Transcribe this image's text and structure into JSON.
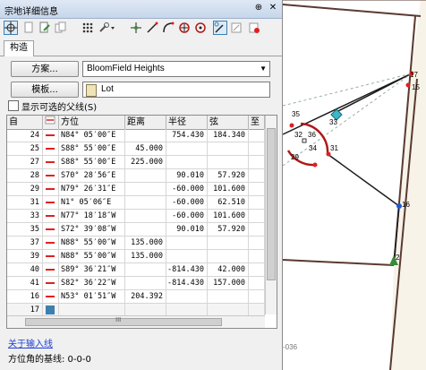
{
  "window": {
    "title": "宗地详细信息",
    "pin": "⊕",
    "close": "✕"
  },
  "tabs": [
    {
      "label": "构造"
    }
  ],
  "scheme": {
    "button": "方案...",
    "value": "BloomField Heights"
  },
  "template": {
    "button": "模板...",
    "value": "Lot"
  },
  "show_parent": {
    "label": "显示可选的父线(S)",
    "checked": false
  },
  "grid": {
    "columns": [
      "自",
      "",
      "方位",
      "距离",
      "半径",
      "弦",
      "至"
    ],
    "rows": [
      {
        "from": "24",
        "bearing": "N84° 05′00″E",
        "distance": "",
        "radius": "754.430",
        "chord": "184.340"
      },
      {
        "from": "25",
        "bearing": "S88° 55′00″E",
        "distance": "45.000",
        "radius": "",
        "chord": ""
      },
      {
        "from": "27",
        "bearing": "S88° 55′00″E",
        "distance": "225.000",
        "radius": "",
        "chord": ""
      },
      {
        "from": "28",
        "bearing": "S70° 28′56″E",
        "distance": "",
        "radius": "90.010",
        "chord": "57.920"
      },
      {
        "from": "29",
        "bearing": "N79° 26′31″E",
        "distance": "",
        "radius": "-60.000",
        "chord": "101.600"
      },
      {
        "from": "31",
        "bearing": "N1° 05′06″E",
        "distance": "",
        "radius": "-60.000",
        "chord": "62.510"
      },
      {
        "from": "33",
        "bearing": "N77° 18′18″W",
        "distance": "",
        "radius": "-60.000",
        "chord": "101.600"
      },
      {
        "from": "35",
        "bearing": "S72° 39′08″W",
        "distance": "",
        "radius": "90.010",
        "chord": "57.920"
      },
      {
        "from": "37",
        "bearing": "N88° 55′00″W",
        "distance": "135.000",
        "radius": "",
        "chord": ""
      },
      {
        "from": "39",
        "bearing": "N88° 55′00″W",
        "distance": "135.000",
        "radius": "",
        "chord": ""
      },
      {
        "from": "40",
        "bearing": "S89° 36′21″W",
        "distance": "",
        "radius": "-814.430",
        "chord": "42.000"
      },
      {
        "from": "41",
        "bearing": "S82° 36′22″W",
        "distance": "",
        "radius": "-814.430",
        "chord": "157.000"
      },
      {
        "from": "16",
        "bearing": "N53° 01′51″W",
        "distance": "204.392",
        "radius": "",
        "chord": ""
      },
      {
        "from": "17",
        "bearing": "",
        "distance": "",
        "radius": "",
        "chord": ""
      }
    ],
    "hscroll_label": "III"
  },
  "link": "关于输入线",
  "footer": "方位角的基线: 0-0-0",
  "map": {
    "labels": [
      "35",
      "33",
      "32",
      "36",
      "34",
      "31",
      "29",
      "17",
      "15",
      "16",
      "2",
      "-036"
    ]
  },
  "colors": {
    "accent": "#3c7fb1",
    "line_red": "#e02020",
    "arc_red": "#b01818",
    "parcel_brown": "#5a3a30"
  }
}
